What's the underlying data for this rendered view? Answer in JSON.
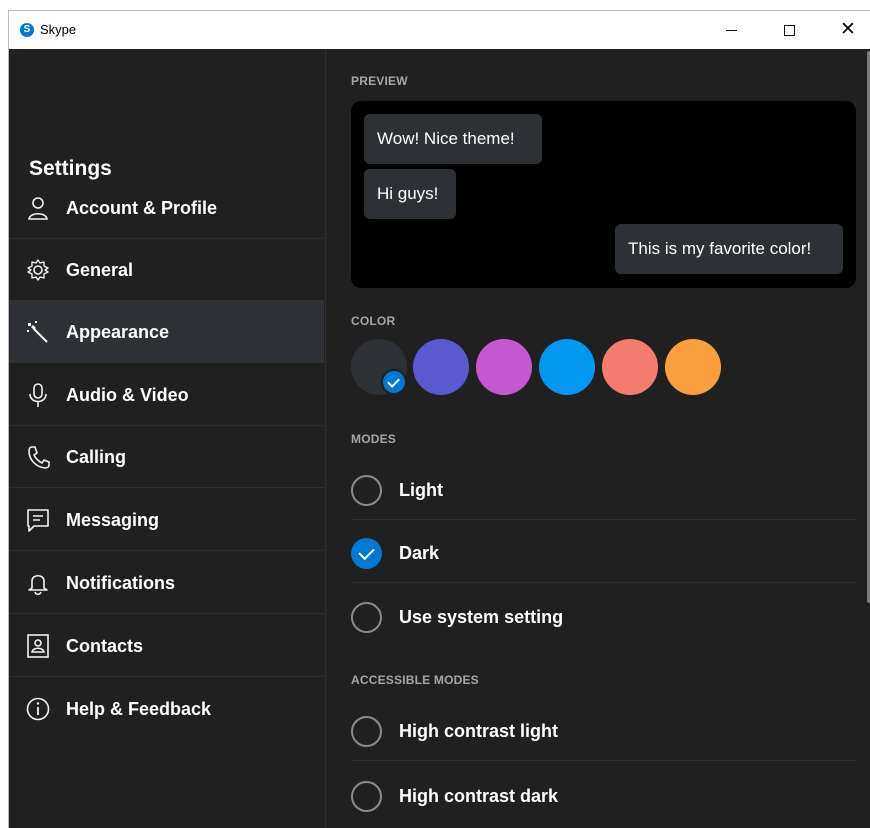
{
  "window": {
    "title": "Skype",
    "app_icon_letter": "S",
    "close_glyph": "✕"
  },
  "sidebar": {
    "title": "Settings",
    "items": [
      {
        "label": "Account & Profile",
        "icon": "person-icon"
      },
      {
        "label": "General",
        "icon": "gear-icon"
      },
      {
        "label": "Appearance",
        "icon": "magic-wand-icon",
        "selected": true
      },
      {
        "label": "Audio & Video",
        "icon": "microphone-icon"
      },
      {
        "label": "Calling",
        "icon": "phone-icon"
      },
      {
        "label": "Messaging",
        "icon": "message-icon"
      },
      {
        "label": "Notifications",
        "icon": "bell-icon"
      },
      {
        "label": "Contacts",
        "icon": "contact-card-icon"
      },
      {
        "label": "Help & Feedback",
        "icon": "info-icon"
      }
    ]
  },
  "preview": {
    "label": "PREVIEW",
    "messages": [
      {
        "text": "Wow! Nice theme!",
        "side": "left"
      },
      {
        "text": "Hi guys!",
        "side": "left"
      },
      {
        "text": "This is my favorite color!",
        "side": "right"
      }
    ]
  },
  "color": {
    "label": "COLOR",
    "swatches": [
      "#2d3035",
      "#5b59d1",
      "#c657d2",
      "#0098f0",
      "#f47c6f",
      "#fb9f3e"
    ],
    "selected_index": 0
  },
  "modes": {
    "label": "MODES",
    "options": [
      {
        "label": "Light",
        "checked": false
      },
      {
        "label": "Dark",
        "checked": true
      },
      {
        "label": "Use system setting",
        "checked": false
      }
    ]
  },
  "accessible_modes": {
    "label": "ACCESSIBLE MODES",
    "options": [
      {
        "label": "High contrast light",
        "checked": false
      },
      {
        "label": "High contrast dark",
        "checked": false
      }
    ]
  },
  "colors": {
    "accent": "#0078d4",
    "background": "#202020",
    "selected_nav": "#2d3035",
    "bubble": "#2d3035"
  }
}
